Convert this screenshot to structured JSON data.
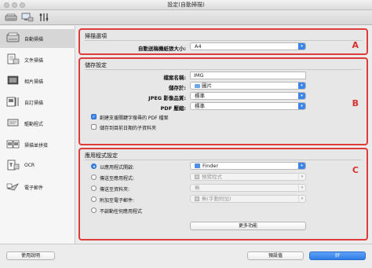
{
  "window": {
    "title": "設定(自動掃描)"
  },
  "toolbar": {
    "icons": [
      "scanner-icon",
      "computer-scanner-icon",
      "tools-icon"
    ]
  },
  "sidebar": {
    "items": [
      {
        "label": "自動掃描",
        "icon": "auto-scan-icon",
        "selected": true
      },
      {
        "label": "文件掃描",
        "icon": "document-scan-icon",
        "selected": false
      },
      {
        "label": "相片掃描",
        "icon": "photo-scan-icon",
        "selected": false
      },
      {
        "label": "自訂掃描",
        "icon": "custom-scan-icon",
        "selected": false
      },
      {
        "label": "驅動程式",
        "icon": "driver-icon",
        "selected": false
      },
      {
        "label": "掃描並拼接",
        "icon": "scan-stitch-icon",
        "selected": false
      },
      {
        "label": "OCR",
        "icon": "ocr-icon",
        "selected": false
      },
      {
        "label": "電子郵件",
        "icon": "email-icon",
        "selected": false
      }
    ]
  },
  "scan_options": {
    "title": "掃描選項",
    "letter": "A",
    "paper_size_label": "自動送稿機紙張大小:",
    "paper_size_value": "A4"
  },
  "save_settings": {
    "title": "儲存設定",
    "letter": "B",
    "file_name_label": "檔案名稱:",
    "file_name_value": "IMG",
    "save_in_label": "儲存於:",
    "save_in_value": "圖片",
    "jpeg_quality_label": "JPEG 影像品質:",
    "jpeg_quality_value": "標準",
    "pdf_compression_label": "PDF 壓縮:",
    "pdf_compression_value": "標準",
    "keyword_pdf_label": "創建支援關鍵字搜尋的 PDF 檔案",
    "keyword_pdf_checked": true,
    "date_subfolder_label": "儲存到目前日期的子資料夾",
    "date_subfolder_checked": false
  },
  "app_settings": {
    "title": "應用程式設定",
    "letter": "C",
    "open_with_label": "以應用程式開啟:",
    "open_with_value": "Finder",
    "send_to_app_label": "傳送至應用程式:",
    "send_to_app_value": "預覽程式",
    "send_to_folder_label": "傳送至資料夾:",
    "send_to_folder_value": "無",
    "attach_email_label": "附加至電子郵件:",
    "attach_email_value": "無(手動附加)",
    "no_app_label": "不啟動任何應用程式",
    "selected_option": "open_with",
    "more_functions_label": "更多功能"
  },
  "footer": {
    "help_label": "使用說明",
    "defaults_label": "預設值",
    "ok_label": "好"
  }
}
